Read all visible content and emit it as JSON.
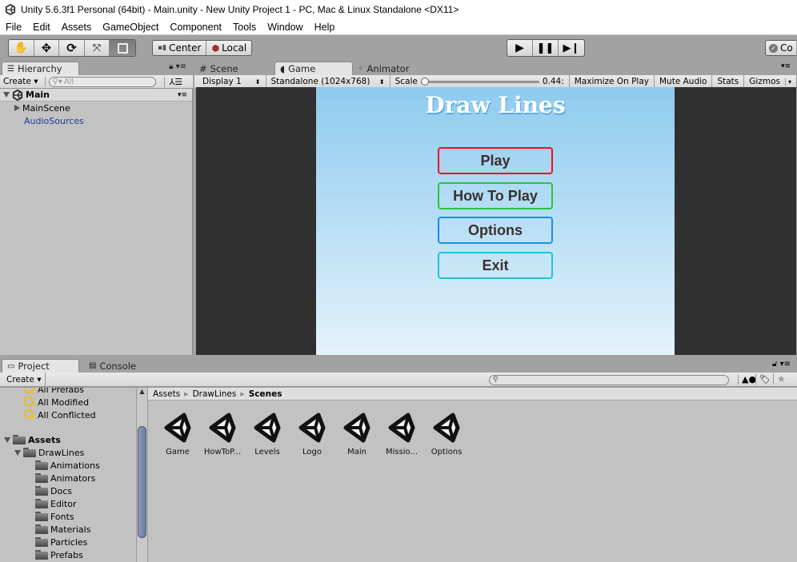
{
  "window": {
    "title": "Unity 5.6.3f1 Personal (64bit) - Main.unity - New Unity Project 1 - PC, Mac & Linux Standalone <DX11>"
  },
  "menu": [
    "File",
    "Edit",
    "Assets",
    "GameObject",
    "Component",
    "Tools",
    "Window",
    "Help"
  ],
  "toolbar": {
    "tools": [
      "hand-tool",
      "move-tool",
      "rotate-tool",
      "scale-tool",
      "rect-tool"
    ],
    "active_tool": "rect-tool",
    "pivot_label": "Center",
    "space_label": "Local",
    "collab_label": "Co"
  },
  "hierarchy": {
    "tab": "Hierarchy",
    "create": "Create",
    "search_placeholder": "All",
    "scene": "Main",
    "items": [
      {
        "label": "MainScene",
        "expandable": true
      },
      {
        "label": "AudioSources",
        "expandable": false,
        "color": "#1a3c9c"
      }
    ]
  },
  "view_tabs": [
    {
      "label": "Scene",
      "active": false
    },
    {
      "label": "Game",
      "active": true
    },
    {
      "label": "Animator",
      "active": false
    }
  ],
  "game_toolbar": {
    "display": "Display 1",
    "resolution": "Standalone (1024x768)",
    "scale_label": "Scale",
    "scale_value": "0.44:",
    "maximize": "Maximize On Play",
    "mute": "Mute Audio",
    "stats": "Stats",
    "gizmos": "Gizmos"
  },
  "game": {
    "title": "Draw Lines",
    "buttons": [
      {
        "label": "Play",
        "color": "#e8141c"
      },
      {
        "label": "How To Play",
        "color": "#22c83a"
      },
      {
        "label": "Options",
        "color": "#1a8cf0"
      },
      {
        "label": "Exit",
        "color": "#22c4d4"
      }
    ]
  },
  "project": {
    "tabs": [
      {
        "label": "Project",
        "active": true
      },
      {
        "label": "Console",
        "active": false
      }
    ],
    "create": "Create",
    "favorites": [
      "All Prefabs",
      "All Modified",
      "All Conflicted"
    ],
    "assets_root": "Assets",
    "folder": "DrawLines",
    "subfolders": [
      "Animations",
      "Animators",
      "Docs",
      "Editor",
      "Fonts",
      "Materials",
      "Particles",
      "Prefabs"
    ],
    "breadcrumb": [
      "Assets",
      "DrawLines",
      "Scenes"
    ],
    "scenes": [
      "Game",
      "HowToP...",
      "Levels",
      "Logo",
      "Main",
      "Missio...",
      "Options"
    ]
  }
}
